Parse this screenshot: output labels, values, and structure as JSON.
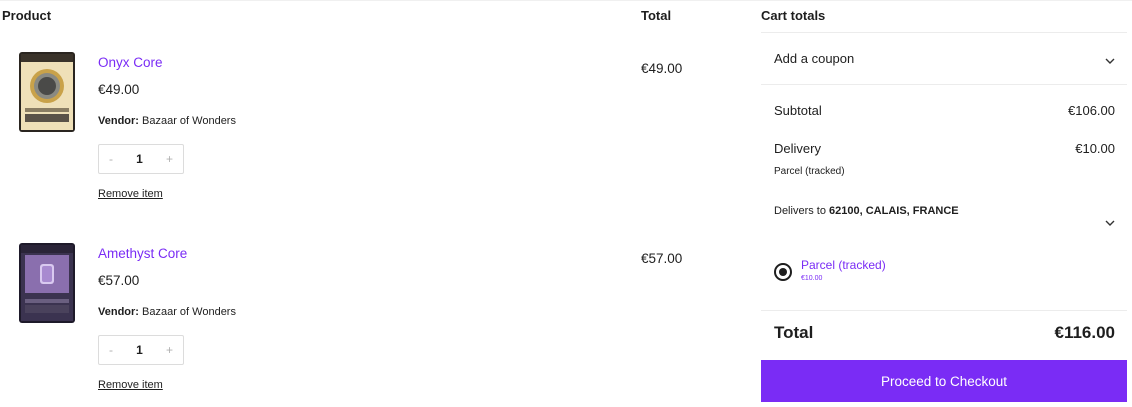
{
  "table": {
    "header_product": "Product",
    "header_total": "Total"
  },
  "items": [
    {
      "name": "Onyx Core",
      "price": "€49.00",
      "vendor_label": "Vendor:",
      "vendor": "Bazaar of Wonders",
      "quantity": "1",
      "minus": "-",
      "plus": "+",
      "remove_label": "Remove item",
      "line_total": "€49.00"
    },
    {
      "name": "Amethyst Core",
      "price": "€57.00",
      "vendor_label": "Vendor:",
      "vendor": "Bazaar of Wonders",
      "quantity": "1",
      "minus": "-",
      "plus": "+",
      "remove_label": "Remove item",
      "line_total": "€57.00"
    }
  ],
  "cart": {
    "title": "Cart totals",
    "coupon_label": "Add a coupon",
    "subtotal_label": "Subtotal",
    "subtotal_value": "€106.00",
    "delivery_label": "Delivery",
    "delivery_value": "€10.00",
    "delivery_method": "Parcel (tracked)",
    "delivers_to_prefix": "Delivers to",
    "delivers_to_address": "62100, CALAIS, FRANCE",
    "shipping_option_label": "Parcel (tracked)",
    "shipping_option_price": "€10.00",
    "total_label": "Total",
    "total_value": "€116.00",
    "checkout_label": "Proceed to Checkout"
  },
  "colors": {
    "accent": "#7a2cf5",
    "text": "#1e1e1e"
  }
}
